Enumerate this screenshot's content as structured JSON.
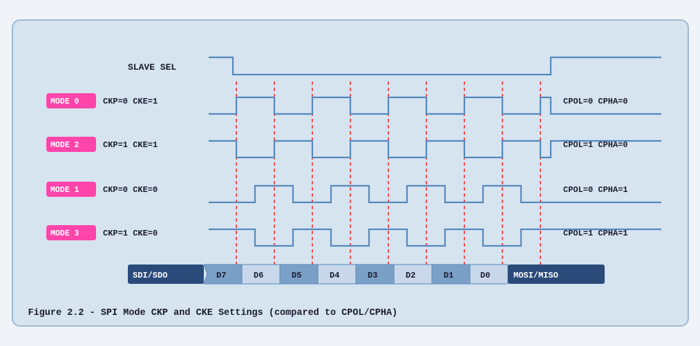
{
  "caption": "Figure 2.2 - SPI Mode CKP and CKE Settings (compared to CPOL/CPHA)",
  "diagram": {
    "slave_sel_label": "SLAVE SEL",
    "modes": [
      {
        "id": "MODE 0",
        "ckp_cke": "CKP=0  CKE=1",
        "cpol_cpha": "CPOL=0  CPHA=0"
      },
      {
        "id": "MODE 2",
        "ckp_cke": "CKP=1  CKE=1",
        "cpol_cpha": "CPOL=1  CPHA=0"
      },
      {
        "id": "MODE 1",
        "ckp_cke": "CKP=0  CKE=0",
        "cpol_cpha": "CPOL=0  CPHA=1"
      },
      {
        "id": "MODE 3",
        "ckp_cke": "CKP=1  CKE=0",
        "cpol_cpha": "CPOL=1  CPHA=1"
      }
    ],
    "data_bits": [
      "SDI/SDO",
      "D7",
      "D6",
      "D5",
      "D4",
      "D3",
      "D2",
      "D1",
      "D0",
      "MOSI/MISO"
    ]
  }
}
